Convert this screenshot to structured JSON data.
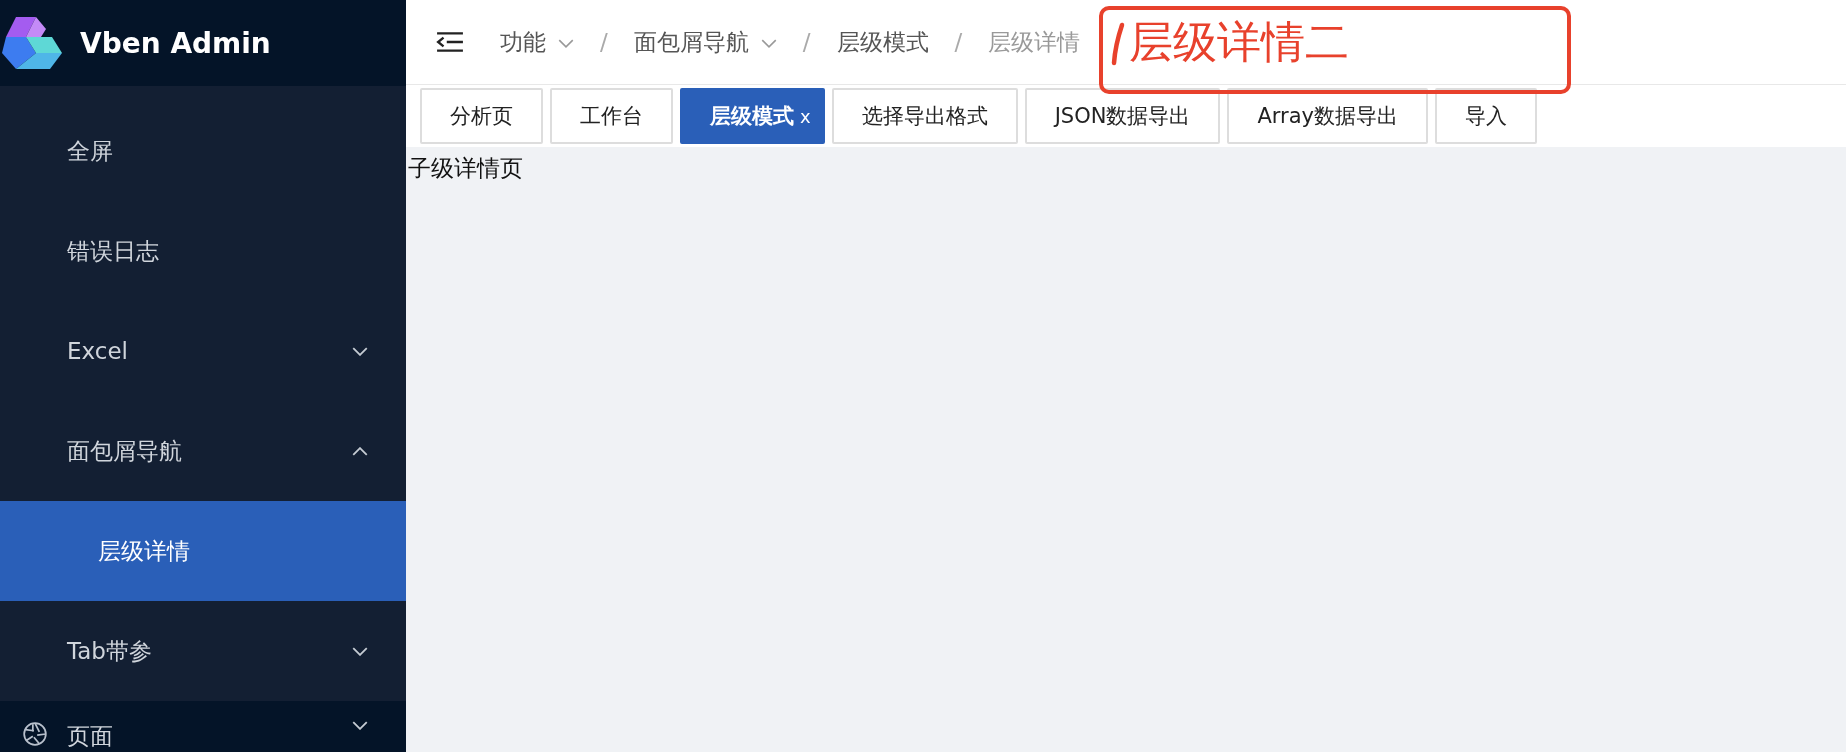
{
  "logo": {
    "title": "Vben Admin"
  },
  "sidebar": {
    "items": [
      {
        "label": "全屏",
        "kind": "sub"
      },
      {
        "label": "错误日志",
        "kind": "sub"
      },
      {
        "label": "Excel",
        "kind": "sub",
        "expanded": false
      },
      {
        "label": "面包屑导航",
        "kind": "sub",
        "expanded": true,
        "children": [
          {
            "label": "层级详情",
            "selected": true
          }
        ]
      },
      {
        "label": "Tab带参",
        "kind": "sub",
        "expanded": false
      },
      {
        "label": "页面",
        "kind": "top",
        "expanded": false
      }
    ]
  },
  "breadcrumb": [
    {
      "label": "功能",
      "dropdown": true
    },
    {
      "separator": "/",
      "label": "面包屑导航",
      "dropdown": true
    },
    {
      "separator": "/",
      "label": "层级模式",
      "dropdown": false
    },
    {
      "separator": "/",
      "label": "层级详情",
      "dropdown": false,
      "current": true
    }
  ],
  "tabs": [
    {
      "label": "分析页",
      "selected": false
    },
    {
      "label": "工作台",
      "selected": false
    },
    {
      "label": "层级模式",
      "selected": true,
      "close": "x"
    },
    {
      "label": "选择导出格式",
      "selected": false
    },
    {
      "label": "JSON数据导出",
      "selected": false
    },
    {
      "label": "Array数据导出",
      "selected": false
    },
    {
      "label": "导入",
      "selected": false
    }
  ],
  "content": {
    "text": "子级详情页"
  },
  "annotation": {
    "text": "层级详情二"
  }
}
